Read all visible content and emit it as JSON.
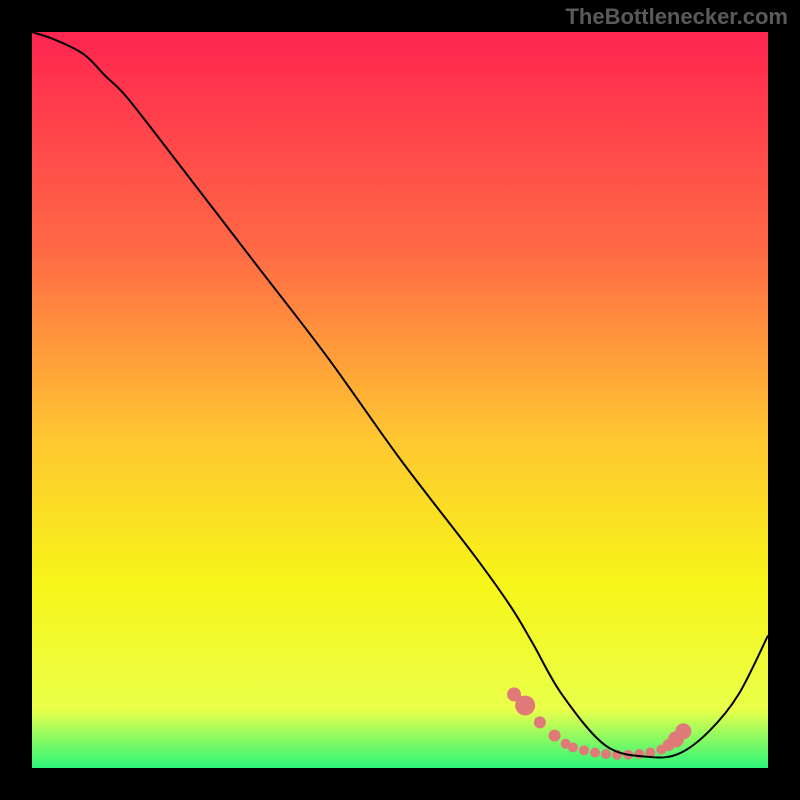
{
  "watermark": "TheBottlenecker.com",
  "chart_data": {
    "type": "line",
    "title": "",
    "xlabel": "",
    "ylabel": "",
    "xlim": [
      0,
      100
    ],
    "ylim": [
      0,
      100
    ],
    "background_gradient": {
      "stops": [
        {
          "offset": 0,
          "color": "#ff2550"
        },
        {
          "offset": 30,
          "color": "#ff6a45"
        },
        {
          "offset": 55,
          "color": "#ffc631"
        },
        {
          "offset": 75,
          "color": "#f7f618"
        },
        {
          "offset": 92,
          "color": "#eaff4a"
        },
        {
          "offset": 100,
          "color": "#2bf57a"
        }
      ]
    },
    "series": [
      {
        "name": "curve",
        "color": "#000000",
        "x": [
          0,
          3,
          7,
          10,
          13,
          20,
          30,
          40,
          50,
          60,
          65,
          68,
          72,
          78,
          84,
          88,
          92,
          96,
          100
        ],
        "y": [
          100,
          99,
          97,
          94,
          91,
          82,
          69,
          56,
          42,
          29,
          22,
          17,
          10,
          3,
          1.5,
          2,
          5,
          10,
          18
        ]
      }
    ],
    "markers": {
      "name": "highlight",
      "color": "#e07a78",
      "x": [
        65.5,
        67,
        69,
        71,
        72.5,
        73.5,
        75,
        76.5,
        78,
        79.5,
        81,
        82.5,
        84,
        85.5,
        86.5,
        87.5,
        88.5
      ],
      "y": [
        10,
        8.5,
        6.2,
        4.4,
        3.3,
        2.8,
        2.4,
        2.1,
        1.9,
        1.8,
        1.8,
        1.9,
        2.1,
        2.5,
        3.1,
        3.9,
        5.0
      ],
      "sizes": [
        7,
        10,
        6,
        6,
        5,
        5,
        5,
        5,
        5,
        5,
        5,
        5,
        5,
        5,
        6,
        8,
        8
      ]
    }
  }
}
